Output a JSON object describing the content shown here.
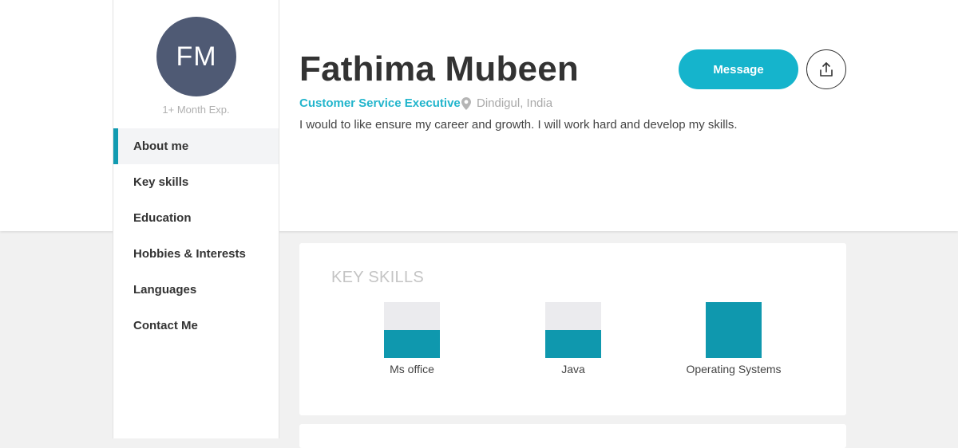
{
  "sidebar": {
    "avatar_initials": "FM",
    "experience": "1+ Month Exp.",
    "items": [
      {
        "label": "About me",
        "active": true
      },
      {
        "label": "Key skills",
        "active": false
      },
      {
        "label": "Education",
        "active": false
      },
      {
        "label": "Hobbies & Interests",
        "active": false
      },
      {
        "label": "Languages",
        "active": false
      },
      {
        "label": "Contact Me",
        "active": false
      }
    ]
  },
  "profile": {
    "name": "Fathima Mubeen",
    "role": "Customer Service Executive",
    "location": "Dindigul, India",
    "bio": "I would to like ensure my career and growth. I will work hard and develop my skills."
  },
  "actions": {
    "message_label": "Message",
    "share_icon": "share-upload-icon"
  },
  "key_skills": {
    "title": "KEY SKILLS",
    "skills": [
      {
        "name": "Ms office",
        "level": 0.5
      },
      {
        "name": "Java",
        "level": 0.5
      },
      {
        "name": "Operating Systems",
        "level": 1.0
      }
    ]
  },
  "colors": {
    "accent": "#15b4cc",
    "role_text": "#22b5cc",
    "skill_fill": "#0f98ae",
    "avatar_bg": "#4f5a74"
  }
}
